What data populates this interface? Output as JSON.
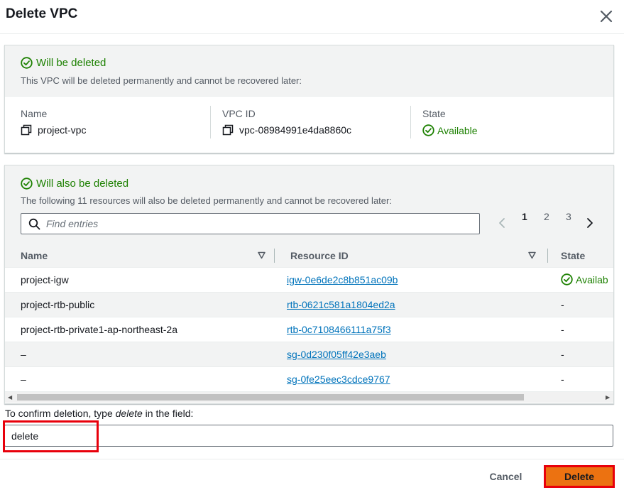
{
  "dialog": {
    "title": "Delete VPC",
    "close_icon": "close-icon"
  },
  "vpc_panel": {
    "status_title": "Will be deleted",
    "description": "This VPC will be deleted permanently and cannot be recovered later:",
    "name_label": "Name",
    "name_value": "project-vpc",
    "vpc_id_label": "VPC ID",
    "vpc_id_value": "vpc-08984991e4da8860c",
    "state_label": "State",
    "state_value": "Available"
  },
  "resources_panel": {
    "status_title": "Will also be deleted",
    "description": "The following 11 resources will also be deleted permanently and cannot be recovered later:",
    "search_placeholder": "Find entries",
    "pagination": {
      "pages": [
        "1",
        "2",
        "3"
      ],
      "current": "1"
    },
    "columns": [
      "Name",
      "Resource ID",
      "State"
    ],
    "rows": [
      {
        "name": "project-igw",
        "resource_id": "igw-0e6de2c8b851ac09b",
        "state": "Availab"
      },
      {
        "name": "project-rtb-public",
        "resource_id": "rtb-0621c581a1804ed2a",
        "state": "-"
      },
      {
        "name": "project-rtb-private1-ap-northeast-2a",
        "resource_id": "rtb-0c7108466111a75f3",
        "state": "-"
      },
      {
        "name": "–",
        "resource_id": "sg-0d230f05ff42e3aeb",
        "state": "-"
      },
      {
        "name": "–",
        "resource_id": "sg-0fe25eec3cdce9767",
        "state": "-"
      }
    ]
  },
  "confirm": {
    "label_prefix": "To confirm deletion, type ",
    "label_keyword": "delete",
    "label_suffix": " in the field:",
    "input_value": "delete"
  },
  "footer": {
    "cancel_label": "Cancel",
    "delete_label": "Delete"
  },
  "colors": {
    "success": "#1d8102",
    "link": "#0073bb",
    "primary_button": "#ec7211",
    "highlight": "#e8000b"
  }
}
